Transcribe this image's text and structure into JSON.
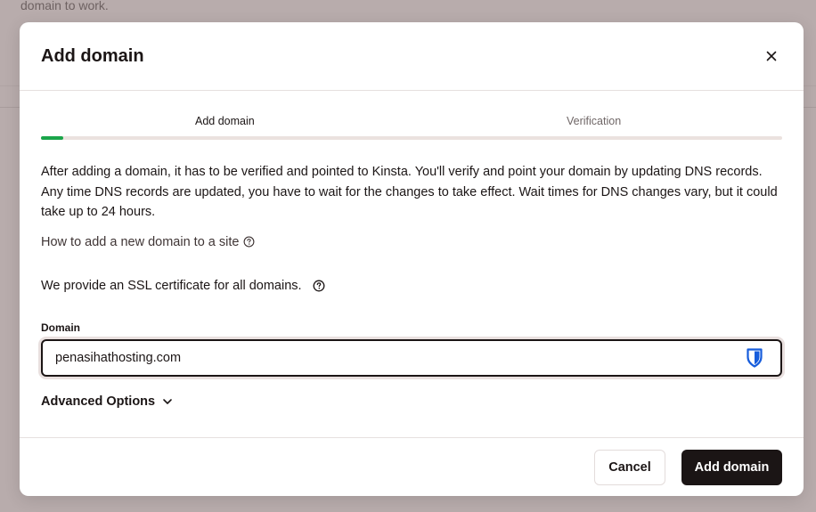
{
  "backdrop": {
    "text": "domain to work."
  },
  "modal": {
    "title": "Add domain",
    "close_label": "×"
  },
  "steps": {
    "items": [
      {
        "label": "Add domain",
        "active": true
      },
      {
        "label": "Verification",
        "active": false
      }
    ],
    "progress_percent": 3
  },
  "content": {
    "description": "After adding a domain, it has to be verified and pointed to Kinsta. You'll verify and point your domain by updating DNS records. Any time DNS records are updated, you have to wait for the changes to take effect. Wait times for DNS changes vary, but it could take up to 24 hours.",
    "help_link": "How to add a new domain to a site",
    "ssl_text": "We provide an SSL certificate for all domains.",
    "domain_label": "Domain",
    "domain_value": "penasihathosting.com",
    "advanced_label": "Advanced Options"
  },
  "footer": {
    "cancel_label": "Cancel",
    "submit_label": "Add domain"
  },
  "colors": {
    "accent_green": "#1aa54a",
    "primary_dark": "#1b1515",
    "password_manager_blue": "#175ddc"
  }
}
